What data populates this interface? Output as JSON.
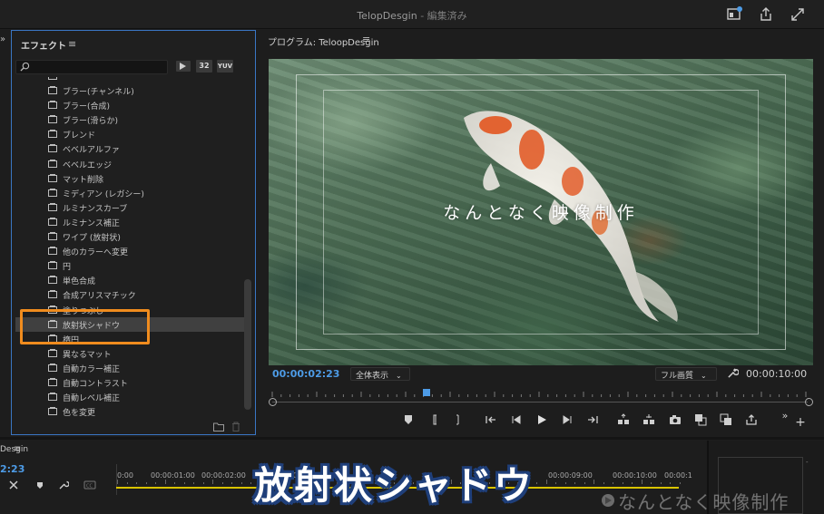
{
  "window": {
    "title": "TelopDesgin",
    "title_suffix": "- 編集済み"
  },
  "effects_panel": {
    "title": "エフェクト",
    "menu": "≡",
    "search_placeholder": "",
    "filters": [
      "32",
      "YUV"
    ],
    "items": [
      {
        "label": "ブラー(チャンネル)"
      },
      {
        "label": "ブラー(合成)"
      },
      {
        "label": "ブラー(滑らか)"
      },
      {
        "label": "ブレンド"
      },
      {
        "label": "ベベルアルファ"
      },
      {
        "label": "ベベルエッジ"
      },
      {
        "label": "マット削除"
      },
      {
        "label": "ミディアン (レガシー)"
      },
      {
        "label": "ルミナンスカーブ"
      },
      {
        "label": "ルミナンス補正"
      },
      {
        "label": "ワイプ (放射状)"
      },
      {
        "label": "他のカラーへ変更"
      },
      {
        "label": "円"
      },
      {
        "label": "単色合成"
      },
      {
        "label": "合成アリスマチック"
      },
      {
        "label": "塗りつぶし"
      },
      {
        "label": "放射状シャドウ",
        "selected": true
      },
      {
        "label": "楕円"
      },
      {
        "label": "異なるマット"
      },
      {
        "label": "自動カラー補正"
      },
      {
        "label": "自動コントラスト"
      },
      {
        "label": "自動レベル補正"
      },
      {
        "label": "色を変更"
      }
    ]
  },
  "program_monitor": {
    "title": "プログラム: TeloopDesgin",
    "menu": "≡",
    "video_caption": "なんとなく映像制作",
    "current_timecode": "00:00:02:23",
    "fit_label": "全体表示",
    "quality_label": "フル画質",
    "duration_timecode": "00:00:10:00",
    "playhead_fraction": 0.29
  },
  "timeline": {
    "title": "Desgin",
    "menu": "≡",
    "timecode": "2:23",
    "ticks": [
      "0:00",
      "00:00:01:00",
      "00:00:02:00",
      "00:00:03:00",
      "00:00:09:00",
      "00:00:10:00",
      "00:00:1"
    ]
  },
  "overlay": {
    "caption": "放射状シャドウ",
    "watermark": "なんとなく映像制作"
  },
  "colors": {
    "accent_blue": "#4d9be6",
    "highlight_orange": "#f08c1e",
    "caption_outline": "#1f3f7a",
    "timeline_yellow": "#d9c400"
  }
}
